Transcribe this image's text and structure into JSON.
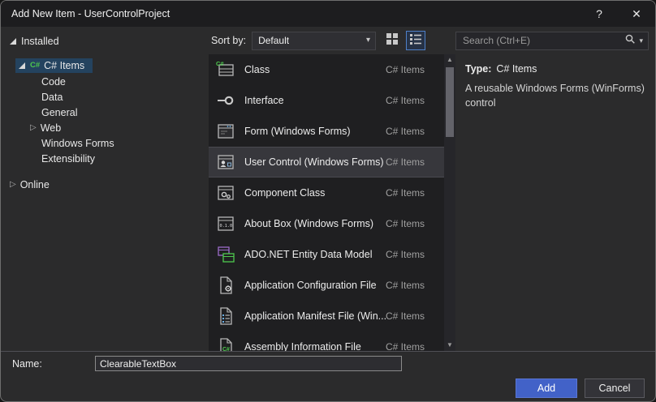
{
  "window": {
    "title": "Add New Item - UserControlProject",
    "help_glyph": "?",
    "close_glyph": "✕"
  },
  "colors": {
    "accent_button": "#4262c8",
    "tree_selection": "#24435f",
    "list_selection": "#37373c",
    "csharp_green": "#4ec94e"
  },
  "sidebar": {
    "nodes": [
      {
        "label": "Installed",
        "expanded": true,
        "level": 0
      },
      {
        "label": "C# Items",
        "expanded": true,
        "level": 1,
        "selected": true,
        "icon": "csharp-items-icon"
      },
      {
        "label": "Code",
        "level": 2
      },
      {
        "label": "Data",
        "level": 2
      },
      {
        "label": "General",
        "level": 2
      },
      {
        "label": "Web",
        "level": 2,
        "expanded": false
      },
      {
        "label": "Windows Forms",
        "level": 2
      },
      {
        "label": "Extensibility",
        "level": 2
      },
      {
        "label": "Online",
        "expanded": false,
        "level": 0
      }
    ]
  },
  "toolbar": {
    "sort_label": "Sort by:",
    "sort_value": "Default",
    "view_buttons": [
      "grid-view",
      "list-view"
    ],
    "selected_view": "list-view",
    "search_placeholder": "Search (Ctrl+E)"
  },
  "list": {
    "items": [
      {
        "label": "Class",
        "category": "C# Items",
        "icon": "class-icon",
        "selected": false
      },
      {
        "label": "Interface",
        "category": "C# Items",
        "icon": "interface-icon",
        "selected": false
      },
      {
        "label": "Form (Windows Forms)",
        "category": "C# Items",
        "icon": "form-icon",
        "selected": false
      },
      {
        "label": "User Control (Windows Forms)",
        "category": "C# Items",
        "icon": "user-control-icon",
        "selected": true
      },
      {
        "label": "Component Class",
        "category": "C# Items",
        "icon": "component-class-icon",
        "selected": false
      },
      {
        "label": "About Box (Windows Forms)",
        "category": "C# Items",
        "icon": "about-box-icon",
        "selected": false
      },
      {
        "label": "ADO.NET Entity Data Model",
        "category": "C# Items",
        "icon": "ado-net-entity-icon",
        "selected": false
      },
      {
        "label": "Application Configuration File",
        "category": "C# Items",
        "icon": "app-config-file-icon",
        "selected": false
      },
      {
        "label": "Application Manifest File (Win...",
        "category": "C# Items",
        "icon": "app-manifest-file-icon",
        "selected": false
      },
      {
        "label": "Assembly Information File",
        "category": "C# Items",
        "icon": "assembly-info-file-icon",
        "selected": false
      }
    ]
  },
  "details": {
    "type_label": "Type:",
    "type_value": "C# Items",
    "description": "A reusable Windows Forms (WinForms) control"
  },
  "footer": {
    "name_label": "Name:",
    "name_value": "ClearableTextBox",
    "add_label": "Add",
    "cancel_label": "Cancel"
  }
}
